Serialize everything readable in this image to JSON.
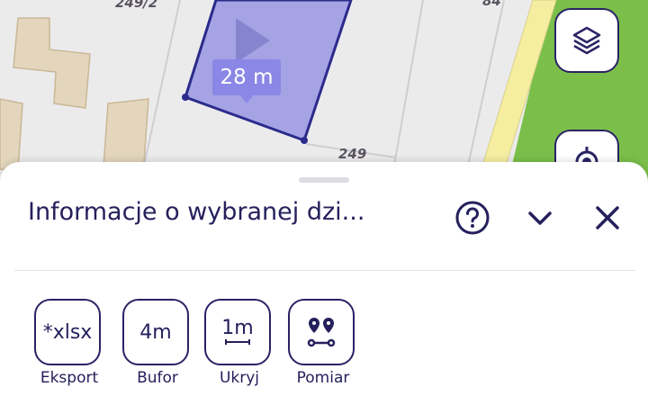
{
  "map": {
    "measurement_label": "28 m",
    "lot_numbers": [
      "249/2",
      "249",
      "84"
    ],
    "colors": {
      "parcel_fill": "#9996e3",
      "parcel_stroke": "#2b2b8c",
      "road": "#f5eda0",
      "grass": "#7bbf4a"
    }
  },
  "map_controls": {
    "layers_icon": "layers-icon",
    "locate_icon": "locate-icon"
  },
  "sheet": {
    "title": "Informacje o wybranej dzi...",
    "help_icon": "help-circle-icon",
    "collapse_icon": "chevron-down-icon",
    "close_icon": "close-icon"
  },
  "tools": [
    {
      "icon_text": "*xlsx",
      "label": "Eksport"
    },
    {
      "icon_text": "4m",
      "label": "Bufor"
    },
    {
      "icon_text": "1m",
      "label": "Ukryj"
    },
    {
      "icon_text": "",
      "label": "Pomiar"
    }
  ]
}
